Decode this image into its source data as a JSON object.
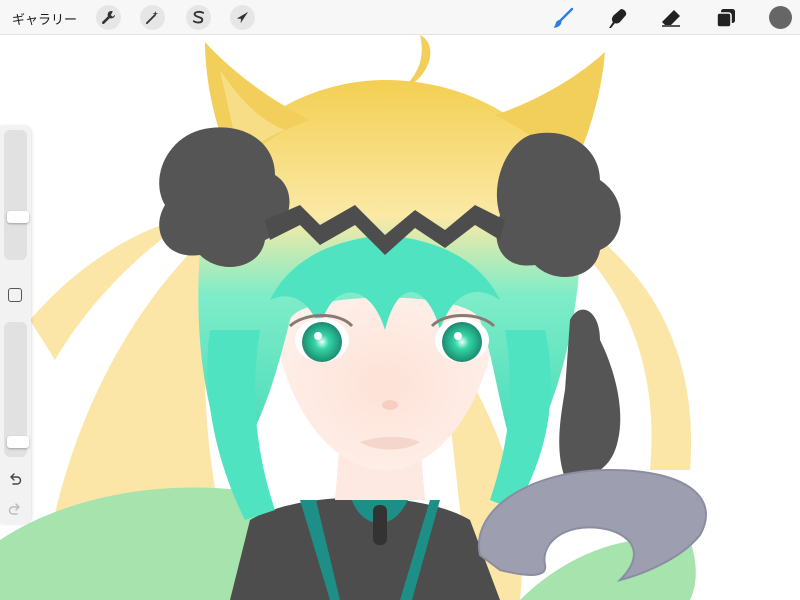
{
  "toolbar": {
    "gallery_label": "ギャラリー",
    "left_tools": [
      {
        "name": "actions",
        "icon": "wrench-icon"
      },
      {
        "name": "adjustments",
        "icon": "magic-wand-icon"
      },
      {
        "name": "selection",
        "icon": "s-ribbon-icon"
      },
      {
        "name": "transform",
        "icon": "arrow-cursor-icon"
      }
    ],
    "right_tools": [
      {
        "name": "brush",
        "icon": "brush-icon",
        "active": true
      },
      {
        "name": "smudge",
        "icon": "smudge-finger-icon"
      },
      {
        "name": "eraser",
        "icon": "eraser-icon"
      },
      {
        "name": "layers",
        "icon": "layers-icon"
      }
    ],
    "current_color": "#666666",
    "active_tool_color": "#2b7de9"
  },
  "sidebar": {
    "brush_size_level": 0.3,
    "opacity_level": 0.05,
    "icons": [
      "modify-square-icon",
      "undo-icon",
      "redo-icon"
    ]
  },
  "artwork": {
    "subject": "anime-girl-illustration",
    "palette": {
      "hair_teal": "#4fe3c1",
      "hair_blond": "#f1cf5a",
      "ribbon_yellow": "#fbe6a8",
      "flower_dark": "#555555",
      "skin": "#fde9e1",
      "eyes": "#35d3a6",
      "outfit_green": "#a6e3ad",
      "outfit_dark": "#4d4d4d",
      "collar_teal": "#1d8f86",
      "ring_gray": "#9d9fb1"
    }
  }
}
